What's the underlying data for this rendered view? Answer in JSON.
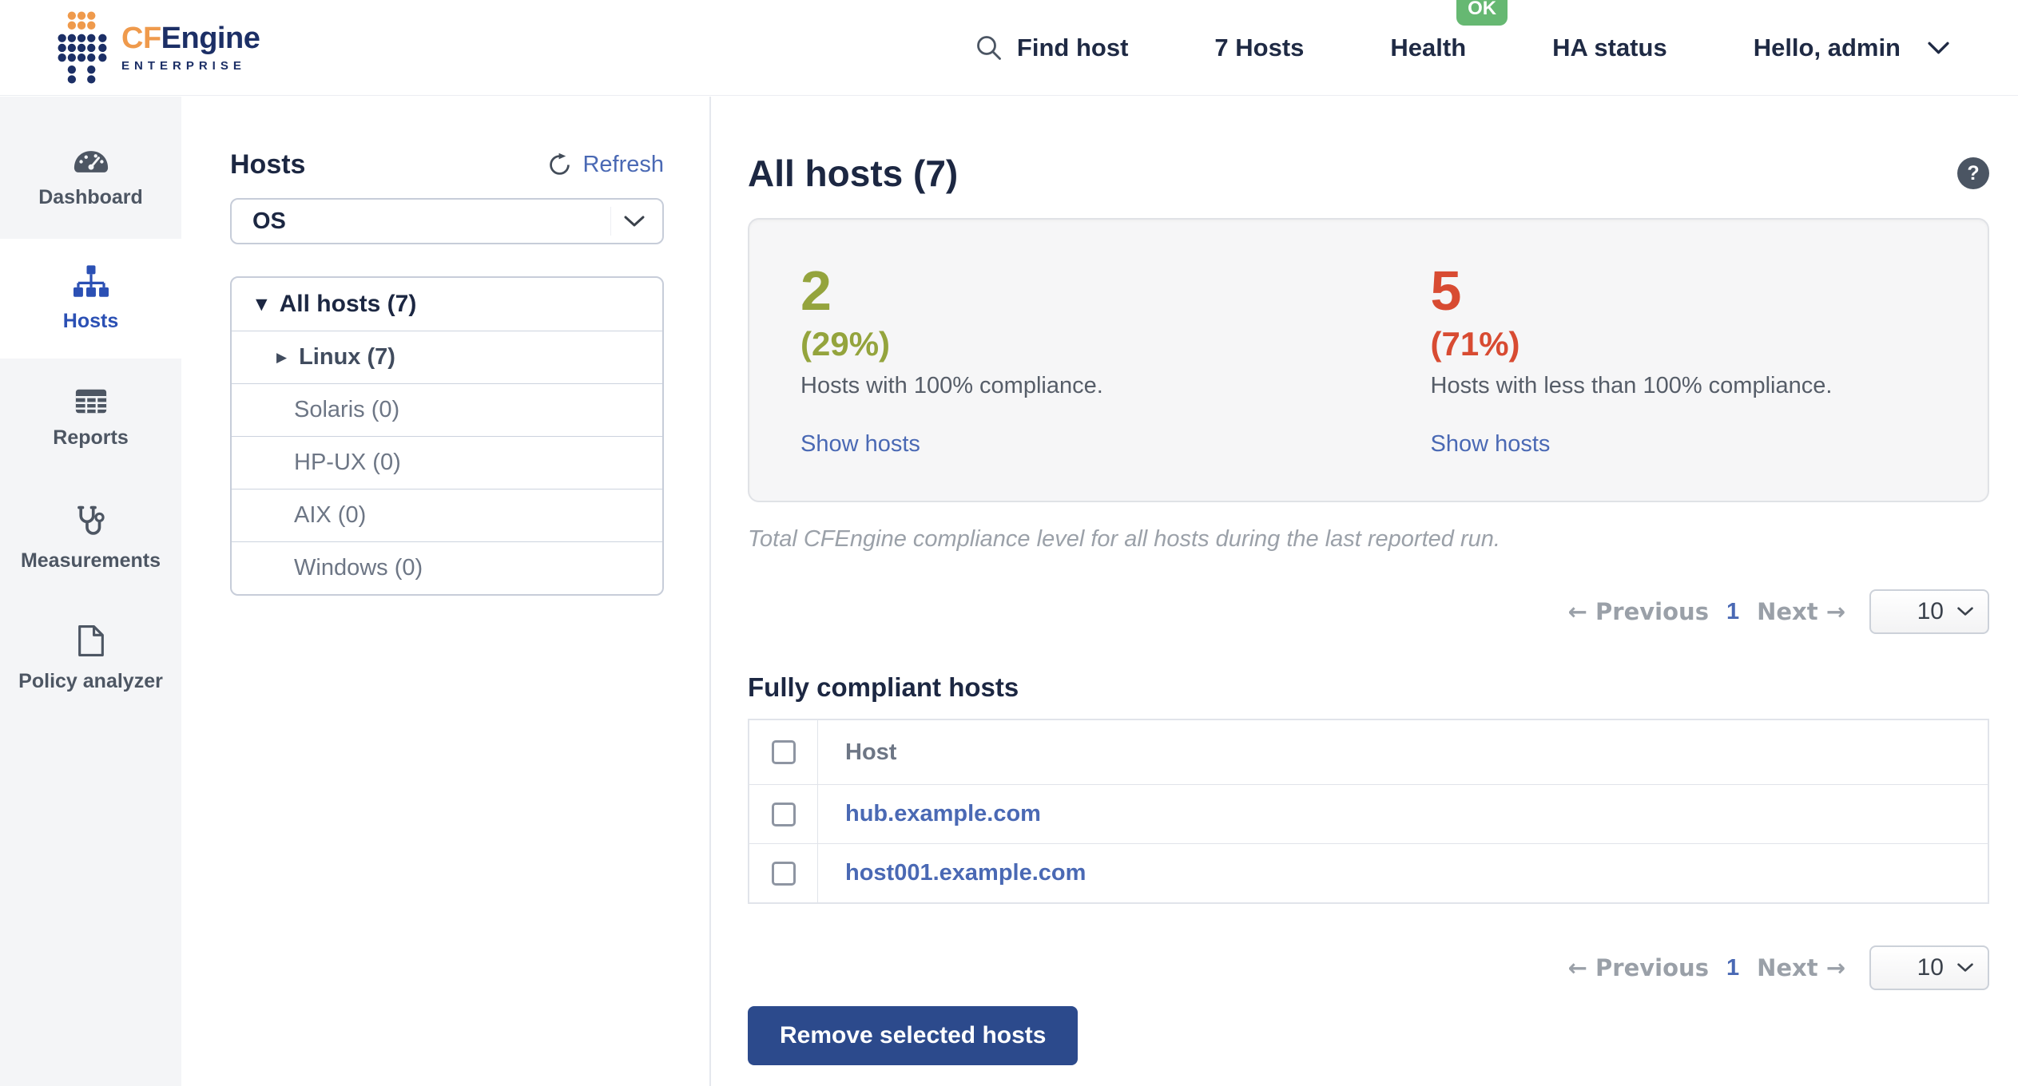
{
  "header": {
    "brand": {
      "cf": "CF",
      "engine": "Engine",
      "subtitle": "ENTERPRISE"
    },
    "nav": {
      "find_host_label": "Find host",
      "hosts_count_label": "7 Hosts",
      "health_label": "Health",
      "health_status_badge": "OK",
      "ha_status_label": "HA status",
      "user_menu_label": "Hello, admin"
    }
  },
  "sidebar": {
    "active_item": "Hosts",
    "items": [
      {
        "label": "Dashboard",
        "icon": "gauge-icon"
      },
      {
        "label": "Hosts",
        "icon": "sitemap-icon"
      },
      {
        "label": "Reports",
        "icon": "table-icon"
      },
      {
        "label": "Measurements",
        "icon": "stethoscope-icon"
      },
      {
        "label": "Policy analyzer",
        "icon": "document-icon"
      }
    ]
  },
  "hosts_panel": {
    "title": "Hosts",
    "refresh_label": "Refresh",
    "filter_selected": "OS",
    "tree": [
      {
        "label": "All hosts (7)",
        "arrow": "▼",
        "expanded": true
      },
      {
        "label": "Linux (7)",
        "arrow": "▶",
        "expanded": false
      },
      {
        "label": "Solaris (0)",
        "arrow": ""
      },
      {
        "label": "HP-UX (0)",
        "arrow": ""
      },
      {
        "label": "AIX (0)",
        "arrow": ""
      },
      {
        "label": "Windows (0)",
        "arrow": ""
      }
    ]
  },
  "main": {
    "title": "All hosts (7)",
    "help_label": "?",
    "stats": [
      {
        "count": "2",
        "percent": "(29%)",
        "description": "Hosts with 100% compliance.",
        "link_label": "Show hosts",
        "color": "#94a43d"
      },
      {
        "count": "5",
        "percent": "(71%)",
        "description": "Hosts with less than 100% compliance.",
        "link_label": "Show hosts",
        "color": "#d84b32"
      }
    ],
    "caption": "Total CFEngine compliance level for all hosts during the last reported run.",
    "pagination": {
      "previous_label": "← Previous",
      "current_page": "1",
      "next_label": "Next →",
      "page_size": "10"
    },
    "compliant_section": {
      "heading": "Fully compliant hosts",
      "columns": [
        "Host"
      ],
      "rows": [
        "hub.example.com",
        "host001.example.com"
      ]
    },
    "remove_button_label": "Remove selected hosts"
  },
  "colors": {
    "accent_blue": "#2b50b4",
    "link_blue": "#4a69b4",
    "button_navy": "#2c4a8c",
    "ok_green": "#66b872",
    "compliant_green": "#94a43d",
    "noncompliant_red": "#d84b32",
    "navy_text": "#1c2742",
    "logo_orange": "#ef9a4c",
    "logo_navy": "#1c2f66"
  }
}
